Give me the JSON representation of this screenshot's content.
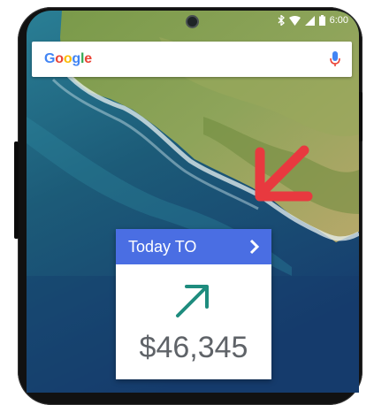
{
  "status_bar": {
    "time": "6:00",
    "icons": [
      "bluetooth-icon",
      "wifi-icon",
      "signal-icon",
      "battery-icon"
    ]
  },
  "search": {
    "logo": "Google",
    "icons": [
      "mic-icon"
    ]
  },
  "widget": {
    "title": "Today TO",
    "amount": "$46,345",
    "trend": "up",
    "icons": [
      "chevron-right-icon",
      "trend-up-icon"
    ]
  },
  "colors": {
    "widget_header": "#4a6ee3",
    "trend_arrow": "#1e8c7e",
    "annotation_arrow": "#e8393f"
  }
}
